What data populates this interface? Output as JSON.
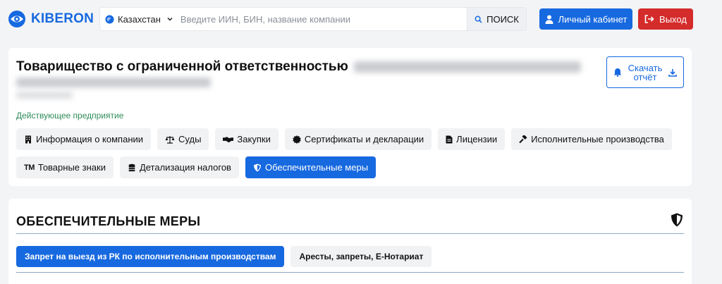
{
  "header": {
    "logo_text": "KIBERON",
    "country": "Казахстан",
    "search_placeholder": "Введите ИИН, БИН, название компании",
    "search_button": "ПОИСК",
    "cabinet_button": "Личный кабинет",
    "exit_button": "Выход",
    "colors": {
      "primary": "#1769e0",
      "danger": "#d42b2b"
    }
  },
  "company": {
    "legal_form": "Товарищество с ограниченной ответственностью",
    "status": "Действующее предприятие",
    "download_label": "Скачать отчёт",
    "status_color": "#2e8b57"
  },
  "tabs": [
    {
      "label": "Информация о компании",
      "icon": "building-icon"
    },
    {
      "label": "Суды",
      "icon": "scales-icon"
    },
    {
      "label": "Закупки",
      "icon": "handshake-icon"
    },
    {
      "label": "Сертификаты и декларации",
      "icon": "certificate-icon"
    },
    {
      "label": "Лицензии",
      "icon": "document-icon"
    },
    {
      "label": "Исполнительные производства",
      "icon": "gavel-icon"
    },
    {
      "label": "Товарные знаки",
      "icon": "trademark-icon"
    },
    {
      "label": "Детализация налогов",
      "icon": "coins-icon"
    },
    {
      "label": "Обеспечительные меры",
      "icon": "shield-icon",
      "active": true
    }
  ],
  "measures": {
    "title": "ОБЕСПЕЧИТЕЛЬНЫЕ МЕРЫ",
    "subtabs": [
      {
        "label": "Запрет на выезд из РК по исполнительным производствам",
        "active": true
      },
      {
        "label": "Аресты, запреты, E-Нотариат",
        "active": false
      }
    ]
  }
}
